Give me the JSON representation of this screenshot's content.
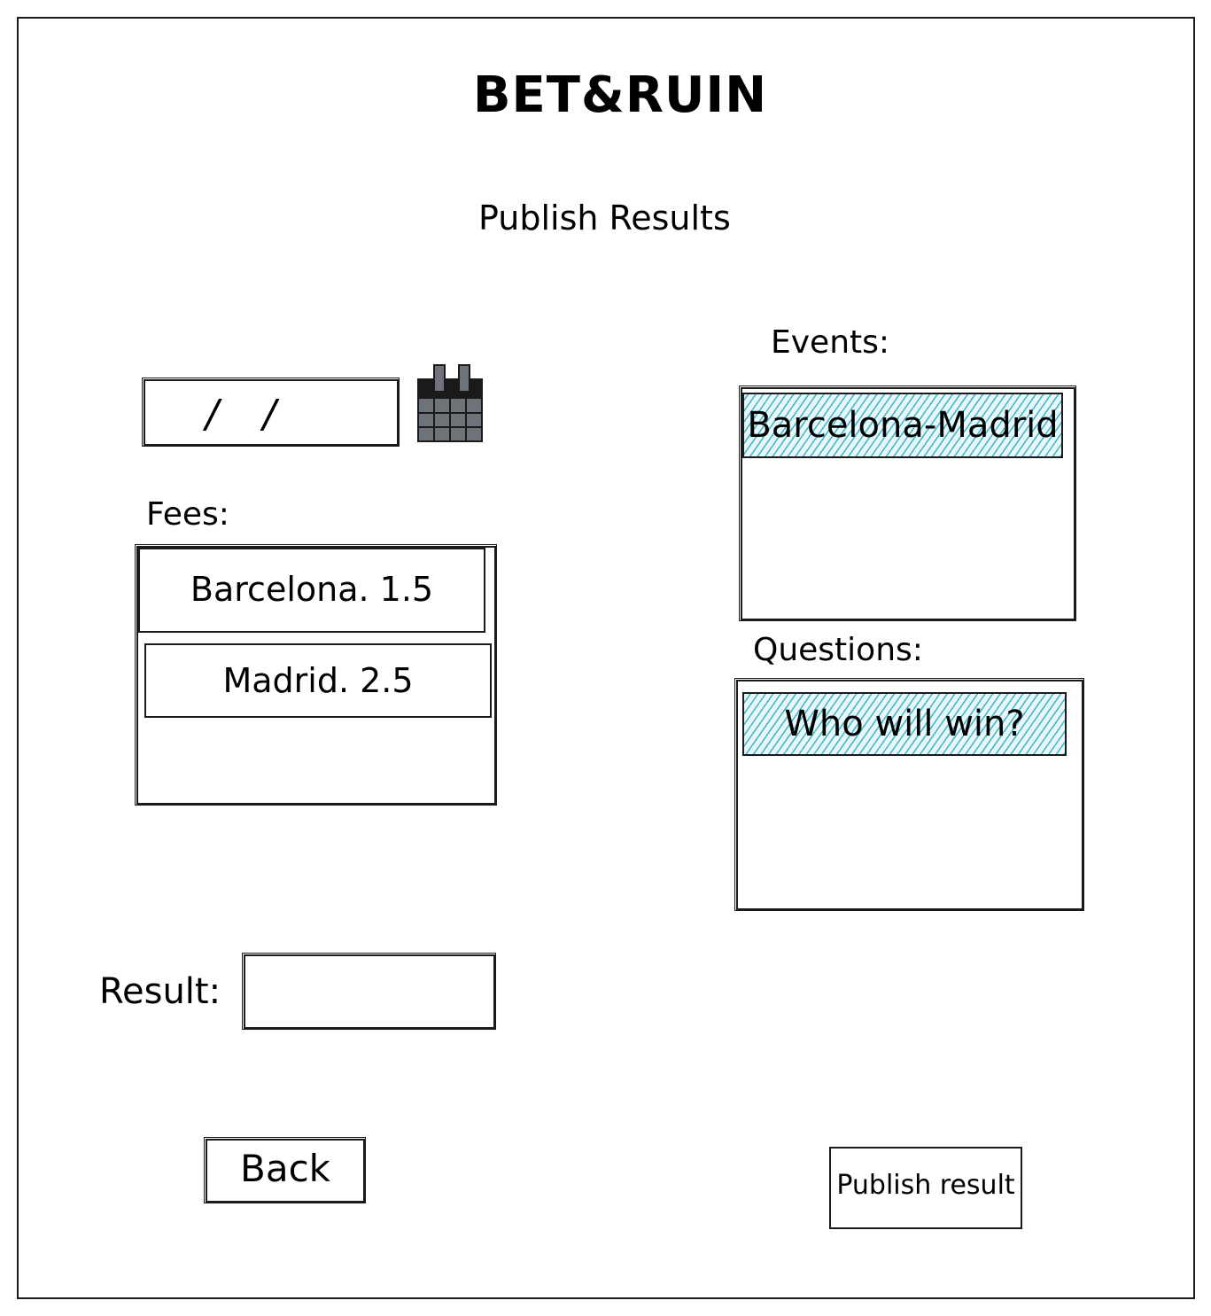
{
  "app": {
    "title": "BET&RUIN",
    "page_title": "Publish Results"
  },
  "date_field": {
    "value": "/ /"
  },
  "icons": {
    "calendar": "calendar-icon"
  },
  "fees": {
    "label": "Fees:",
    "items": [
      {
        "label": "Barcelona. 1.5"
      },
      {
        "label": "Madrid. 2.5"
      }
    ]
  },
  "events": {
    "label": "Events:",
    "items": [
      {
        "label": "Barcelona-Madrid",
        "selected": true
      }
    ]
  },
  "questions": {
    "label": "Questions:",
    "items": [
      {
        "label": "Who will win?",
        "selected": true
      }
    ]
  },
  "result": {
    "label": "Result:",
    "value": ""
  },
  "buttons": {
    "back": "Back",
    "publish": "Publish result"
  },
  "colors": {
    "selection_hatch": "#3fb5c8",
    "stroke": "#1a1a1a"
  }
}
